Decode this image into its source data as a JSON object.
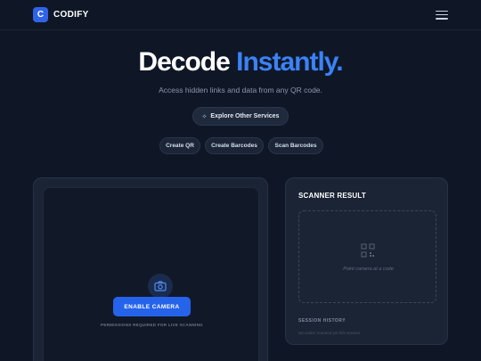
{
  "header": {
    "logo_letter": "C",
    "brand": "CODIFY",
    "menu_icon": "hamburger-menu-icon"
  },
  "hero": {
    "title_part1": "Decode",
    "title_part2": "Instantly.",
    "subtitle": "Access hidden links and data from any QR code.",
    "accent_color": "#3b82f6"
  },
  "explore_button": {
    "label": "Explore Other Services",
    "icon": "sparkle-icon"
  },
  "nav_pills": [
    {
      "label": "Create QR"
    },
    {
      "label": "Create Barcodes"
    },
    {
      "label": "Scan Barcodes"
    }
  ],
  "scanner": {
    "camera_icon": "camera-icon",
    "enable_button": "ENABLE CAMERA",
    "permission_note": "PERMISSIONS REQUIRED FOR LIVE SCANNING",
    "button_color": "#2563eb"
  },
  "result": {
    "title": "SCANNER RESULT",
    "placeholder_icon": "qr-code-icon",
    "placeholder_text": "Point camera at a code",
    "history_title": "SESSION HISTORY",
    "history_empty": "No codes scanned yet this session"
  }
}
